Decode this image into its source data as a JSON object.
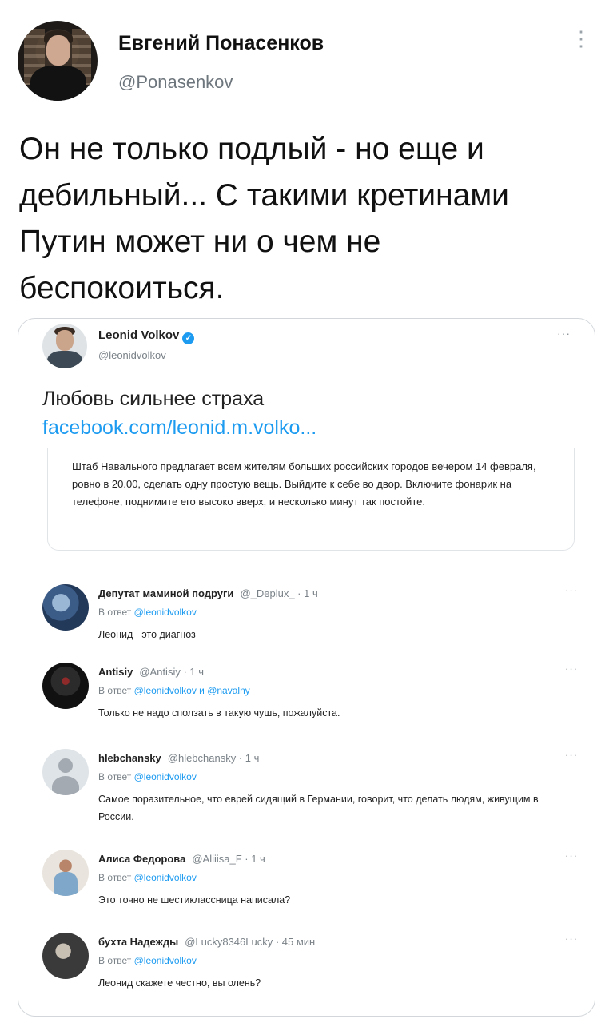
{
  "tweet": {
    "display_name": "Евгений Понасенков",
    "handle": "@Ponasenkov",
    "text": "Он не только подлый - но еще и\nдебильный... С такими кретинами\nПутин может ни о чем не\nбеспокоиться."
  },
  "quoted": {
    "display_name": "Leonid Volkov",
    "verified_icon": "✓",
    "handle": "@leonidvolkov",
    "text": "Любовь сильнее страха",
    "link": "facebook.com/leonid.m.volko...",
    "card_text": "Штаб Навального предлагает всем жителям больших российских городов вечером 14 февраля, ровно в 20.00, сделать одну простую вещь. Выйдите к себе во двор. Включите фонарик на телефоне, поднимите его высоко вверх, и несколько минут так постойте."
  },
  "replies": [
    {
      "name": "Депутат маминой подруги",
      "meta": "@_Deplux_ · 1 ч",
      "reply_prefix": "В ответ",
      "reply_to": "@leonidvolkov",
      "text": "Леонид - это диагноз"
    },
    {
      "name": "Antisiy",
      "meta": "@Antisiy · 1 ч",
      "reply_prefix": "В ответ",
      "reply_to": "@leonidvolkov и @navalny",
      "text": "Только не надо сползать в такую чушь, пожалуйста."
    },
    {
      "name": "hlebchansky",
      "meta": "@hlebchansky · 1 ч",
      "reply_prefix": "В ответ",
      "reply_to": "@leonidvolkov",
      "text": "Самое поразительное, что еврей сидящий в Германии, говорит, что делать людям, живущим в России."
    },
    {
      "name": "Алиса Федорова",
      "meta": "@Aliiisa_F · 1 ч",
      "reply_prefix": "В ответ",
      "reply_to": "@leonidvolkov",
      "text": "Это точно не шестиклассница написала?"
    },
    {
      "name": "бухта Надежды",
      "meta": "@Lucky8346Lucky · 45 мин",
      "reply_prefix": "В ответ",
      "reply_to": "@leonidvolkov",
      "text": "Леонид скажете честно, вы олень?"
    }
  ],
  "icons": {
    "more": "⋮",
    "more_horizontal": "···"
  }
}
